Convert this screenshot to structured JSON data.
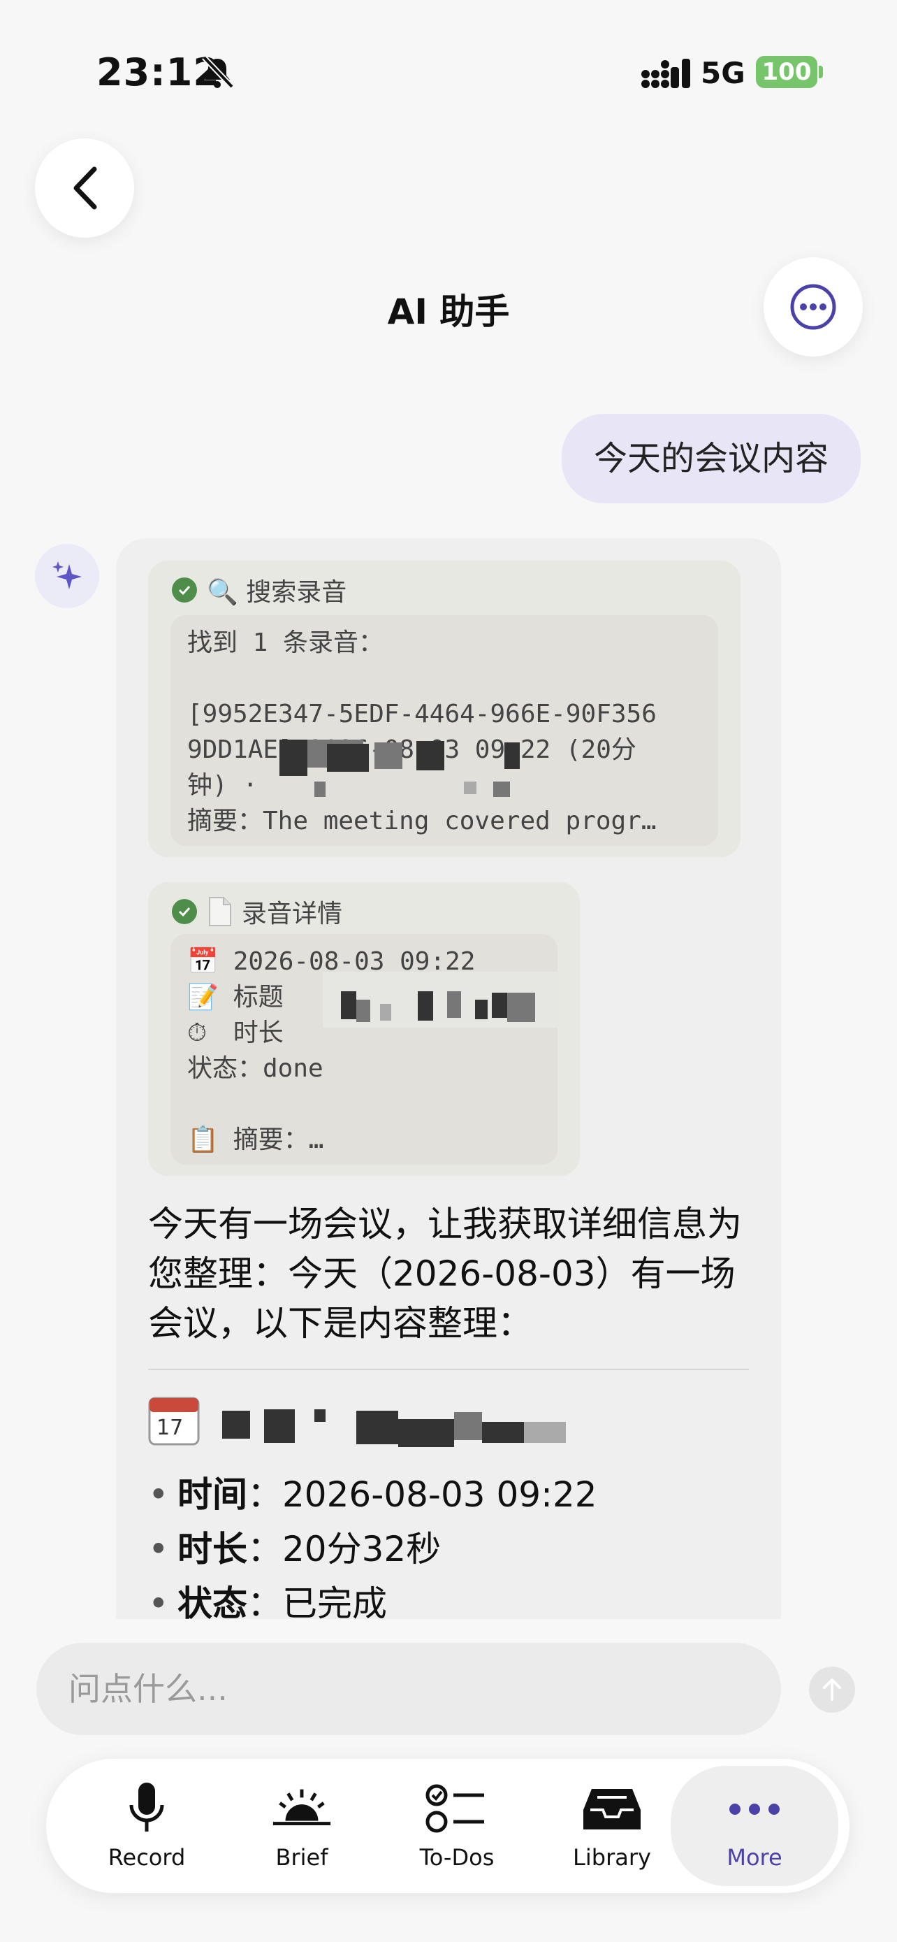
{
  "status_bar": {
    "time": "23:12",
    "network": "5G",
    "battery": "100"
  },
  "header": {
    "title": "AI 助手"
  },
  "user_message": "今天的会议内容",
  "tool_search": {
    "title": "🔍 搜索录音",
    "lines": [
      "找到 1 条录音：",
      "",
      "[9952E347-5EDF-4464-966E-90F356",
      "9DD1AE] 2026-08-03 09:22 (20分",
      "钟) ·",
      "摘要：The meeting covered progr…"
    ]
  },
  "tool_detail": {
    "title": "录音详情",
    "date_line": "2026-08-03 09:22",
    "title_line": "标题",
    "duration_line": "时长",
    "status_line": "状态：done",
    "summary_line": "摘要：…"
  },
  "assistant_text": "今天有一场会议，让我获取详细信息为您整理：今天（2026-08-03）有一场会议，以下是内容整理：",
  "details": [
    {
      "label": "时间",
      "value": "2026-08-03 09:22"
    },
    {
      "label": "时长",
      "value": "20分32秒"
    },
    {
      "label": "状态",
      "value": "已完成"
    }
  ],
  "input": {
    "placeholder": "问点什么..."
  },
  "tabs": [
    {
      "label": "Record",
      "icon": "mic-icon"
    },
    {
      "label": "Brief",
      "icon": "sunrise-icon"
    },
    {
      "label": "To-Dos",
      "icon": "checklist-icon"
    },
    {
      "label": "Library",
      "icon": "tray-icon"
    },
    {
      "label": "More",
      "icon": "ellipsis-icon",
      "active": true
    }
  ],
  "colors": {
    "accent": "#4a42a8",
    "user_bubble": "#e8e6f6",
    "battery": "#77c56a",
    "check": "#4f8d4b"
  }
}
